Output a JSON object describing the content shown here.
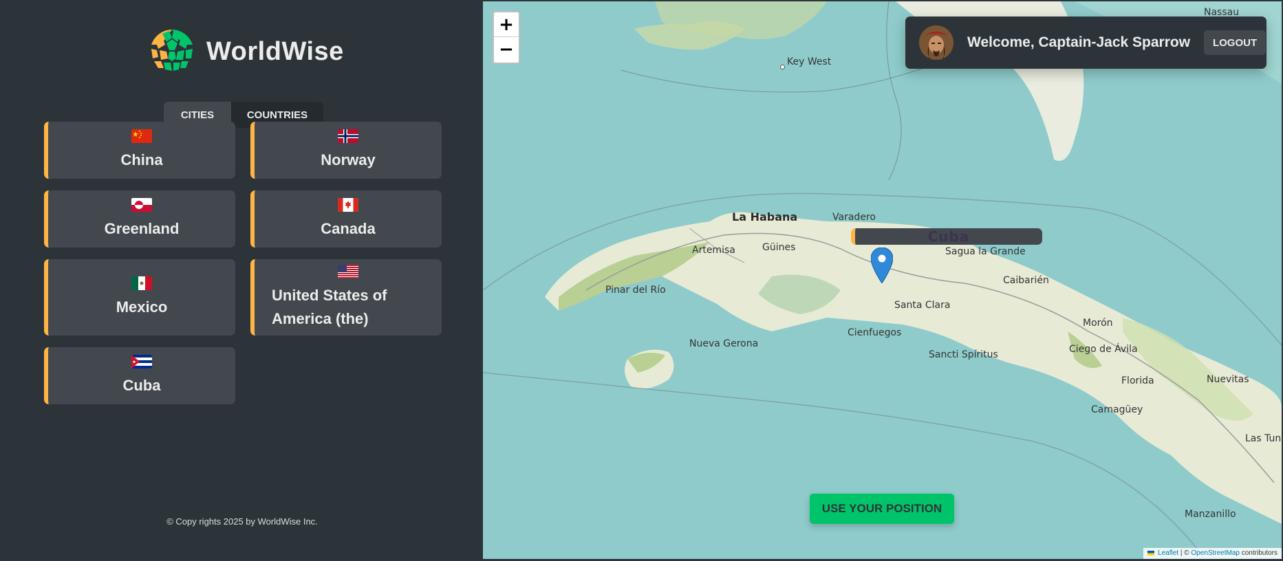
{
  "app": {
    "name": "WorldWise"
  },
  "tabs": {
    "cities": "Cities",
    "countries": "Countries",
    "active": "countries"
  },
  "countries": [
    {
      "name": "China",
      "flag": "cn"
    },
    {
      "name": "Norway",
      "flag": "no"
    },
    {
      "name": "Greenland",
      "flag": "gl"
    },
    {
      "name": "Canada",
      "flag": "ca"
    },
    {
      "name": "Mexico",
      "flag": "mx"
    },
    {
      "name": "United States of America (the)",
      "flag": "us"
    },
    {
      "name": "Cuba",
      "flag": "cu"
    }
  ],
  "footer": {
    "copyright": "© Copy rights 2025 by WorldWise Inc."
  },
  "map": {
    "zoom_in": "+",
    "zoom_out": "−",
    "labels": {
      "key_west": "Key West",
      "nassau": "Nassau",
      "la_habana": "La Habana",
      "varadero": "Varadero",
      "cuba": "Cuba",
      "artemisa": "Artemisa",
      "guines": "Güines",
      "sagua": "Sagua la Grande",
      "caibarien": "Caibarién",
      "pinar": "Pinar del Río",
      "santa_clara": "Santa Clara",
      "cienfuegos": "Cienfuegos",
      "nueva_gerona": "Nueva Gerona",
      "sancti": "Sancti Spíritus",
      "moron": "Morón",
      "ciego": "Ciego de Ávila",
      "florida": "Florida",
      "nuevitas": "Nuevitas",
      "camaguey": "Camagüey",
      "las_tunas": "Las Tuna",
      "manzanillo": "Manzanillo"
    },
    "use_position": "Use your position",
    "attribution": {
      "leaflet": "Leaflet",
      "sep": " | © ",
      "osm": "OpenStreetMap",
      "contributors": " contributors"
    }
  },
  "user": {
    "welcome": "Welcome, Captain-Jack Sparrow",
    "logout": "Logout"
  },
  "colors": {
    "accent": "#ffb545",
    "brand_green": "#00c46a",
    "dark_1": "#2d3439",
    "dark_2": "#42484d",
    "sea": "#8fcbcb"
  }
}
